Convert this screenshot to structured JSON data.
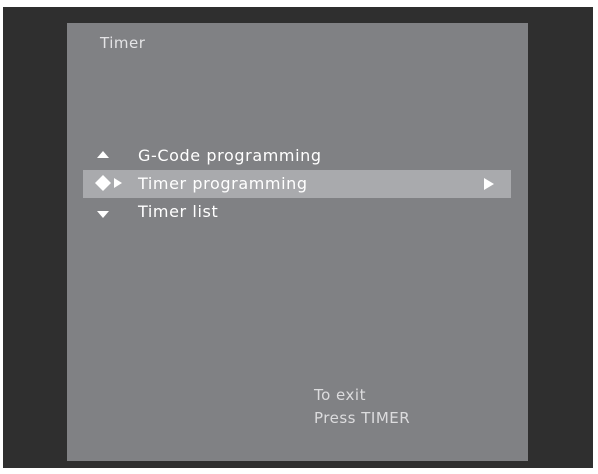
{
  "title": "Timer",
  "menu": {
    "items": [
      {
        "label": "G-Code programming",
        "nav_icon": "up-arrow-icon"
      },
      {
        "label": "Timer programming",
        "nav_icon": "navigation-cross-icon",
        "submenu_icon": "submenu-arrow-icon",
        "selected": true
      },
      {
        "label": "Timer list",
        "nav_icon": "down-arrow-icon"
      }
    ]
  },
  "exit_hint": {
    "line1": "To exit",
    "line2": "Press TIMER"
  },
  "colors": {
    "background": "#2f2f2f",
    "panel": "#808184",
    "highlight": "#a9aaad",
    "text": "#ffffff"
  }
}
